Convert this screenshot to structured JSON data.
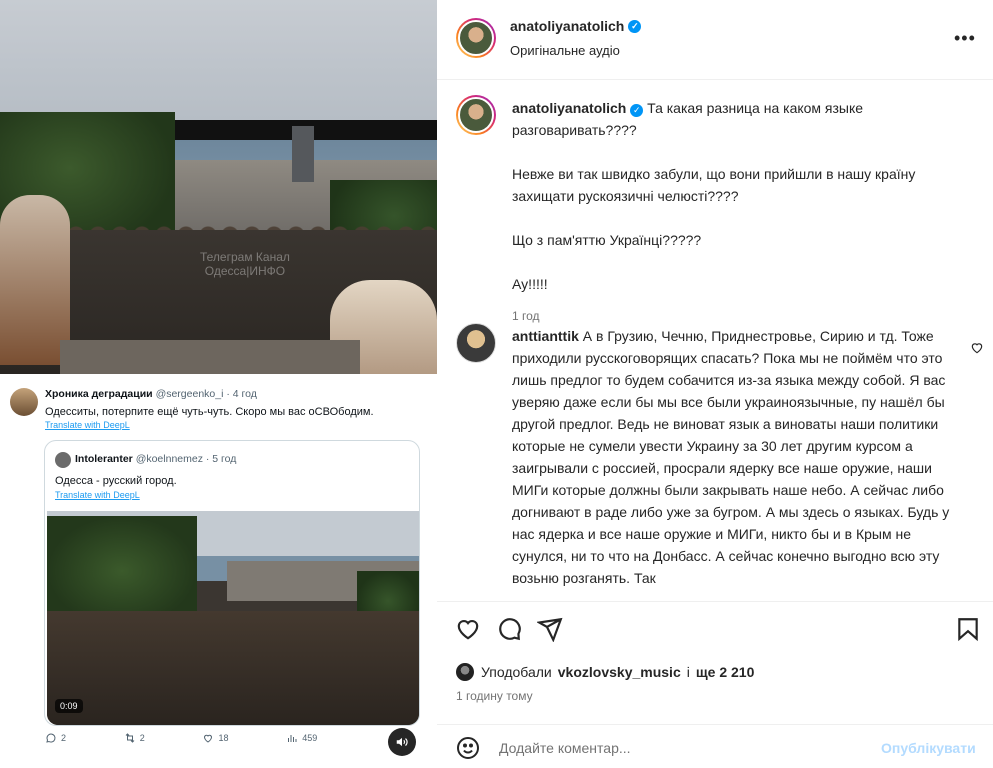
{
  "media": {
    "watermark_line1": "Телеграм Канал",
    "watermark_line2": "Одесса|ИНФО",
    "tweet": {
      "author": "Хроника деградации",
      "handle": "@sergeenko_i",
      "time": "· 4 год",
      "text": "Одесситы, потерпите ещё чуть-чуть. Скоро мы вас оСВОбодим.",
      "translate": "Translate with DeepL",
      "quote": {
        "author": "Intoleranter",
        "handle": "@koelnnemez",
        "time": "· 5 год",
        "text": "Одесса - русский город.",
        "translate": "Translate with DeepL",
        "video_time": "0:09"
      },
      "actions": {
        "replies": "2",
        "retweets": "2",
        "likes": "18",
        "views": "459"
      }
    }
  },
  "header": {
    "username": "anatoliyanatolich",
    "audio": "Оригінальне аудіо",
    "more_icon": "more-horizontal-icon"
  },
  "caption": {
    "username": "anatoliyanatolich",
    "line1": "Та какая разница на каком языке разговаривать????",
    "para2": "Невже ви так швидко забули, що вони прийшли в нашу країну захищати рускоязичні челюсті????",
    "para3": "Що з пам'яттю Українці?????",
    "para4": "Ау!!!!!",
    "time": "1 год"
  },
  "comment": {
    "username": "anttianttik",
    "text": "А в Грузию, Чечню, Приднестровье, Сирию и тд. Тоже приходили русскоговорящих спасать? Пока мы не поймём что это лишь предлог то будем собачится из-за языка между собой. Я вас уверяю даже если бы мы все были украиноязычные, пу нашёл бы другой предлог. Ведь не виноват язык а виноваты наши политики которые не сумели увести Украину за 30 лет другим курсом а заигрывали с россией, просрали ядерку все наше оружие, наши МИГи которые должны были закрывать наше небо. А сейчас либо догнивают в раде либо уже за бугром. А мы здесь о языках. Будь у нас ядерка и все наше оружие и МИГи, никто бы и в Крым не сунулся, ни то что на Донбасс. А сейчас конечно выгодно всю эту возьню розганять. Так"
  },
  "footer": {
    "likes_prefix": "Уподобали",
    "likes_user": "vkozlovsky_music",
    "likes_mid": "і",
    "likes_count": "ще 2 210",
    "time": "1 годину тому",
    "comment_placeholder": "Додайте коментар...",
    "publish": "Опублікувати"
  },
  "colors": {
    "verified": "#0095f6",
    "publish_disabled": "#b3dbff",
    "meta": "#737373"
  }
}
